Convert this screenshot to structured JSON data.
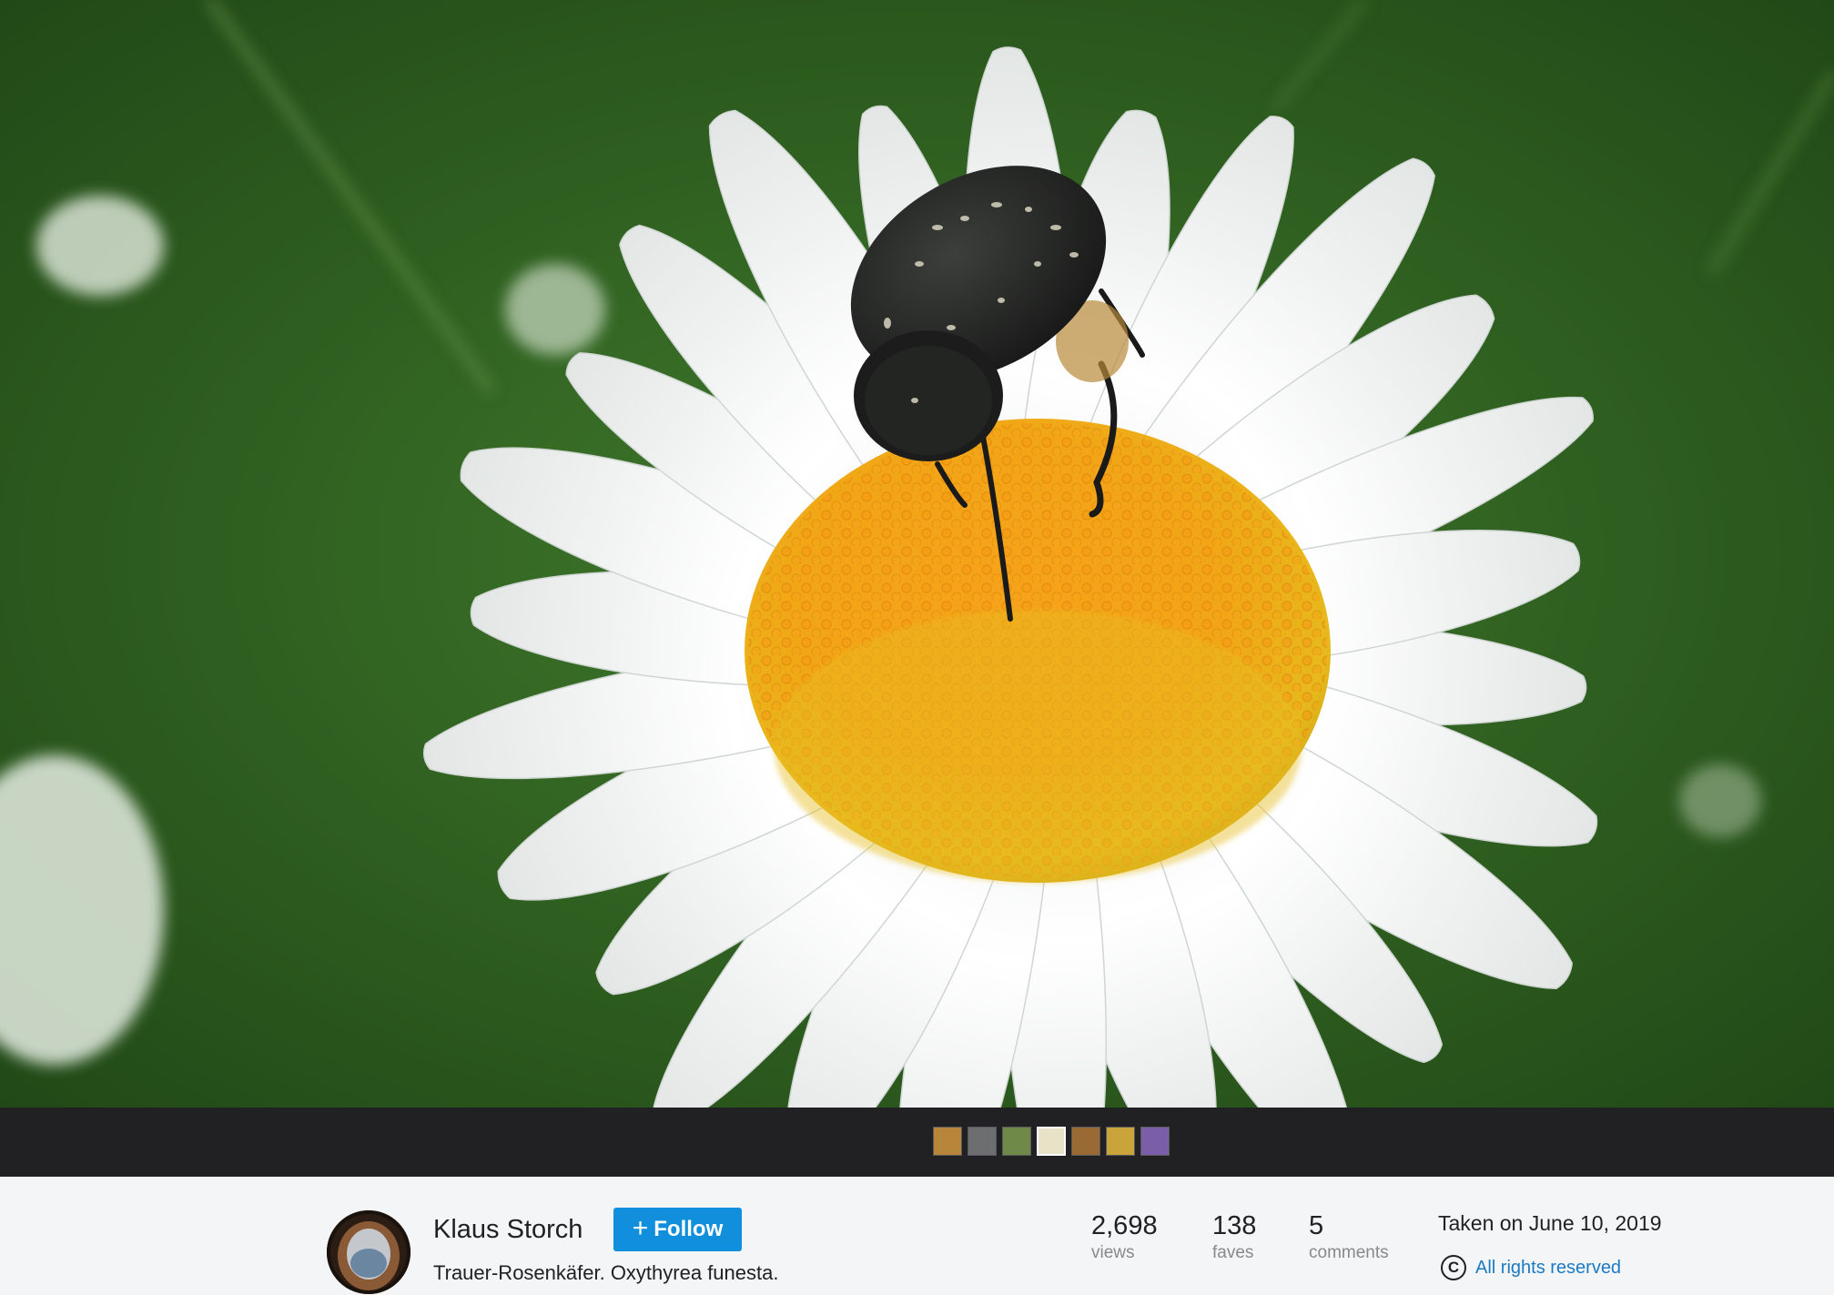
{
  "photo": {
    "subject": "daisy-with-beetle"
  },
  "filmstrip": {
    "thumbnails": [
      {
        "color": "#b8863a",
        "active": false
      },
      {
        "color": "#6d6e70",
        "active": false
      },
      {
        "color": "#6f8a48",
        "active": false
      },
      {
        "color": "#e8e2c8",
        "active": true
      },
      {
        "color": "#9a6a34",
        "active": false
      },
      {
        "color": "#c9a43a",
        "active": false
      },
      {
        "color": "#7b5ea8",
        "active": false
      }
    ]
  },
  "author": {
    "name": "Klaus Storch",
    "avatar_icon": "avatar"
  },
  "follow": {
    "label": "Follow",
    "icon": "plus-icon",
    "color": "#128fdc"
  },
  "photo_info": {
    "description": "Trauer-Rosenkäfer. Oxythyrea funesta."
  },
  "stats": {
    "views": {
      "value": "2,698",
      "label": "views"
    },
    "faves": {
      "value": "138",
      "label": "faves"
    },
    "comments": {
      "value": "5",
      "label": "comments"
    }
  },
  "meta": {
    "taken": "Taken on June 10, 2019",
    "license_icon": "copyright-icon",
    "license_symbol": "C",
    "license": "All rights reserved",
    "link_color": "#1c7ac2"
  }
}
